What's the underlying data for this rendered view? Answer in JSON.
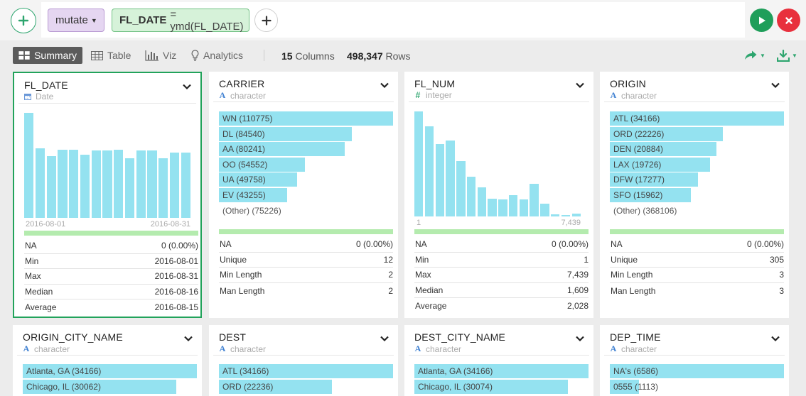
{
  "command": {
    "verb": "mutate",
    "column": "FL_DATE",
    "expression": "= ymd(FL_DATE)"
  },
  "view": {
    "tabs": [
      "Summary",
      "Table",
      "Viz",
      "Analytics"
    ],
    "columns_count": "15",
    "columns_label": "Columns",
    "rows_count": "498,347",
    "rows_label": "Rows"
  },
  "cards": [
    {
      "title": "FL_DATE",
      "type": "Date",
      "type_icon": "calendar-icon",
      "histogram": [
        1.0,
        0.66,
        0.59,
        0.65,
        0.65,
        0.6,
        0.64,
        0.64,
        0.65,
        0.57,
        0.64,
        0.64,
        0.57,
        0.62,
        0.62
      ],
      "axis_min": "2016-08-01",
      "axis_max": "2016-08-31",
      "stats": [
        [
          "NA",
          "0 (0.00%)"
        ],
        [
          "Min",
          "2016-08-01"
        ],
        [
          "Max",
          "2016-08-31"
        ],
        [
          "Median",
          "2016-08-16"
        ],
        [
          "Average",
          "2016-08-15"
        ]
      ]
    },
    {
      "title": "CARRIER",
      "type": "character",
      "type_icon": "text-type-icon",
      "bars": [
        [
          "WN (110775)",
          110775
        ],
        [
          "DL (84540)",
          84540
        ],
        [
          "AA (80241)",
          80241
        ],
        [
          "OO (54552)",
          54552
        ],
        [
          "UA (49758)",
          49758
        ],
        [
          "EV (43255)",
          43255
        ]
      ],
      "other": "(Other) (75226)",
      "stats": [
        [
          "NA",
          "0 (0.00%)"
        ],
        [
          "Unique",
          "12"
        ],
        [
          "Min Length",
          "2"
        ],
        [
          "Man Length",
          "2"
        ]
      ]
    },
    {
      "title": "FL_NUM",
      "type": "integer",
      "type_icon": "hash-icon",
      "histogram": [
        1.0,
        0.86,
        0.69,
        0.72,
        0.53,
        0.38,
        0.28,
        0.17,
        0.16,
        0.2,
        0.16,
        0.31,
        0.12,
        0.02,
        0.01,
        0.03
      ],
      "axis_min": "1",
      "axis_max": "7,439",
      "stats": [
        [
          "NA",
          "0 (0.00%)"
        ],
        [
          "Min",
          "1"
        ],
        [
          "Max",
          "7,439"
        ],
        [
          "Median",
          "1,609"
        ],
        [
          "Average",
          "2,028"
        ]
      ]
    },
    {
      "title": "ORIGIN",
      "type": "character",
      "type_icon": "text-type-icon",
      "bars": [
        [
          "ATL (34166)",
          34166
        ],
        [
          "ORD (22226)",
          22226
        ],
        [
          "DEN (20884)",
          20884
        ],
        [
          "LAX (19726)",
          19726
        ],
        [
          "DFW (17277)",
          17277
        ],
        [
          "SFO (15962)",
          15962
        ]
      ],
      "other": "(Other) (368106)",
      "stats": [
        [
          "NA",
          "0 (0.00%)"
        ],
        [
          "Unique",
          "305"
        ],
        [
          "Min Length",
          "3"
        ],
        [
          "Man Length",
          "3"
        ]
      ]
    },
    {
      "title": "ORIGIN_CITY_NAME",
      "type": "character",
      "type_icon": "text-type-icon",
      "bars": [
        [
          "Atlanta, GA (34166)",
          34166
        ],
        [
          "Chicago, IL (30062)",
          30062
        ]
      ]
    },
    {
      "title": "DEST",
      "type": "character",
      "type_icon": "text-type-icon",
      "bars": [
        [
          "ATL (34166)",
          34166
        ],
        [
          "ORD (22236)",
          22236
        ]
      ]
    },
    {
      "title": "DEST_CITY_NAME",
      "type": "character",
      "type_icon": "text-type-icon",
      "bars": [
        [
          "Atlanta, GA (34166)",
          34166
        ],
        [
          "Chicago, IL (30074)",
          30074
        ]
      ]
    },
    {
      "title": "DEP_TIME",
      "type": "character",
      "type_icon": "text-type-icon",
      "bars": [
        [
          "NA's (6586)",
          6586
        ],
        [
          "0555 (1113)",
          1113
        ]
      ]
    }
  ],
  "colors": {
    "accent_green": "#22a35b",
    "bar_blue": "#94e2f0",
    "na_bar_green": "#b4ebae",
    "mutate_purple": "#e5d6f1",
    "run_green": "#1f9e5a",
    "cancel_red": "#e8303d"
  }
}
